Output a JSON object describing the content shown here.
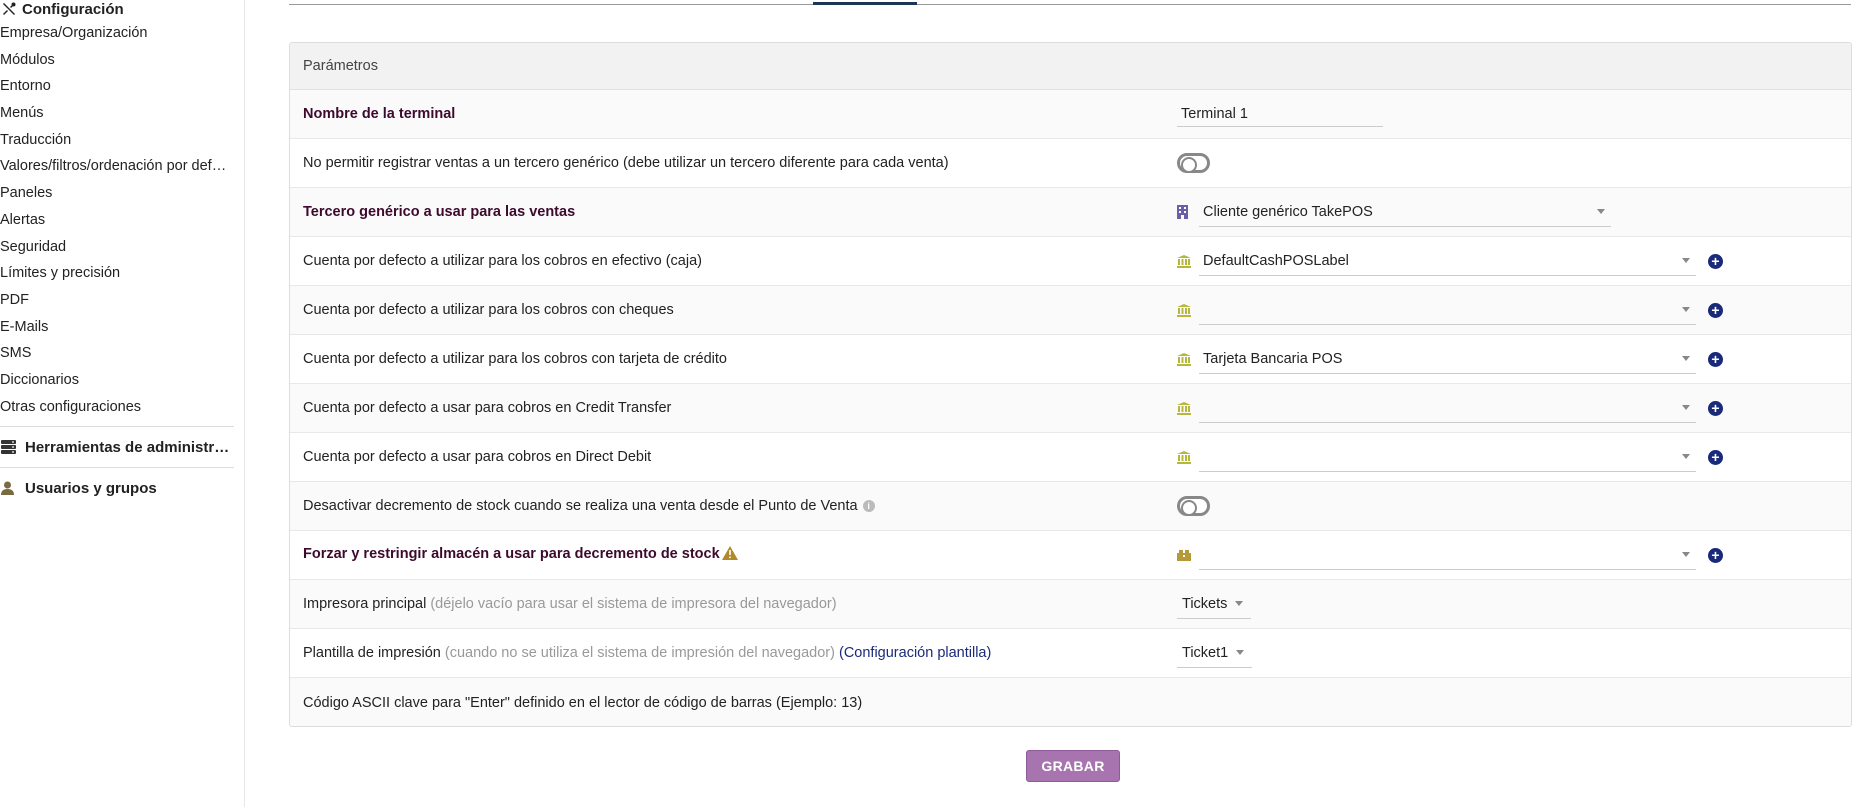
{
  "sidebar": {
    "header": "Configuración",
    "items": [
      "Empresa/Organización",
      "Módulos",
      "Entorno",
      "Menús",
      "Traducción",
      "Valores/filtros/ordenación por def…",
      "Paneles",
      "Alertas",
      "Seguridad",
      "Límites y precisión",
      "PDF",
      "E-Mails",
      "SMS",
      "Diccionarios",
      "Otras configuraciones"
    ],
    "section_admin_tools": "Herramientas de administr…",
    "section_users": "Usuarios y grupos"
  },
  "panel": {
    "title": "Parámetros"
  },
  "rows": {
    "terminal_name": {
      "label": "Nombre de la terminal",
      "value": "Terminal 1"
    },
    "no_generic": {
      "label": "No permitir registrar ventas a un tercero genérico (debe utilizar un tercero diferente para cada venta)"
    },
    "generic_thirdparty": {
      "label": "Tercero genérico a usar para las ventas",
      "value": "Cliente genérico TakePOS"
    },
    "cash_account": {
      "label": "Cuenta por defecto a utilizar para los cobros en efectivo (caja)",
      "value": "DefaultCashPOSLabel"
    },
    "cheque_account": {
      "label": "Cuenta por defecto a utilizar para los cobros con cheques",
      "value": ""
    },
    "card_account": {
      "label": "Cuenta por defecto a utilizar para los cobros con tarjeta de crédito",
      "value": "Tarjeta Bancaria POS"
    },
    "credit_transfer": {
      "label": "Cuenta por defecto a usar para cobros en Credit Transfer",
      "value": ""
    },
    "direct_debit": {
      "label": "Cuenta por defecto a usar para cobros en Direct Debit",
      "value": ""
    },
    "disable_stock": {
      "label": "Desactivar decremento de stock cuando se realiza una venta desde el Punto de Venta"
    },
    "force_warehouse": {
      "label": "Forzar y restringir almacén a usar para decremento de stock",
      "value": ""
    },
    "main_printer": {
      "label": "Impresora principal",
      "hint": "(déjelo vacío para usar el sistema de impresora del navegador)",
      "value": "Tickets"
    },
    "print_template": {
      "label": "Plantilla de impresión",
      "hint": "(cuando no se utiliza el sistema de impresión del navegador)",
      "link": "(Configuración plantilla)",
      "value": "Ticket1"
    },
    "ascii_enter": {
      "label": "Código ASCII clave para \"Enter\" definido en el lector de código de barras (Ejemplo: 13)",
      "value": ""
    }
  },
  "save_button": "GRABAR",
  "colors": {
    "required_label": "#3d0a2e",
    "save_button": "#a874b0",
    "plus_button": "#1a2a7a",
    "bank_icon": "#b5b83a"
  }
}
